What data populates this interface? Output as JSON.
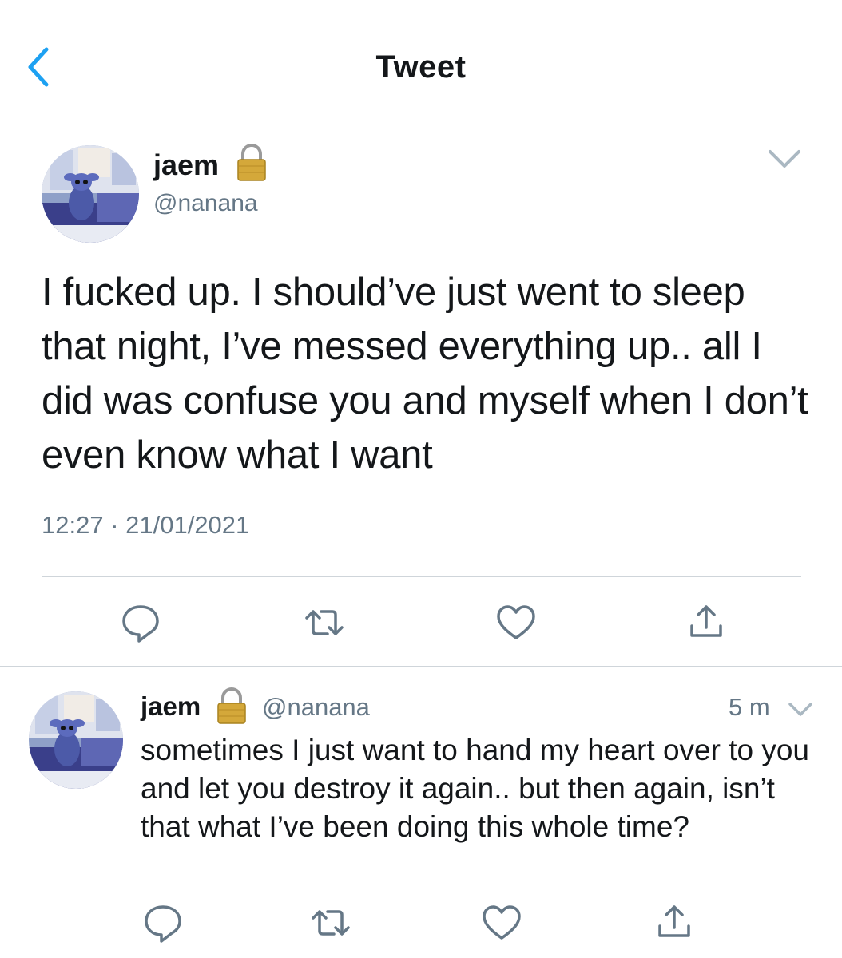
{
  "header": {
    "title": "Tweet"
  },
  "tweet": {
    "name": "jaem",
    "handle": "@nanana",
    "text": "I fucked up. I should’ve just went to sleep that night, I’ve messed everything up.. all I did was confuse you and myself when I don’t even know what I want",
    "timestamp": "12:27 · 21/01/2021",
    "icons": [
      "reply-icon",
      "retweet-icon",
      "like-icon",
      "share-icon"
    ]
  },
  "reply": {
    "name": "jaem",
    "handle": "@nanana",
    "time": "5 m",
    "text": "sometimes I just want to hand my heart over to you and let you destroy it again.. but then again, isn’t that what I’ve been doing this whole time?"
  },
  "colors": {
    "accent": "#1da1f2",
    "secondary_text": "#657786",
    "icon_gray": "#657786",
    "divider": "#cfd5da"
  }
}
